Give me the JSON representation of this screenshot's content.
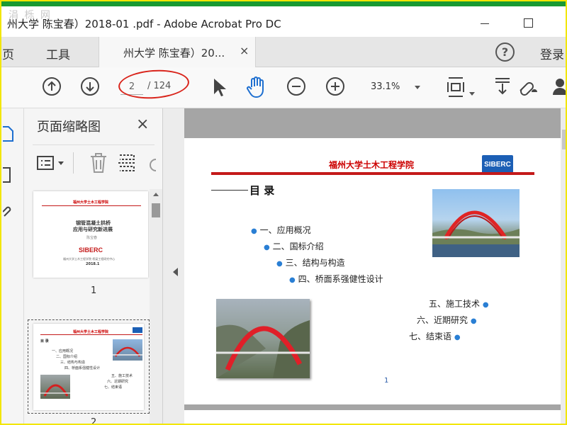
{
  "watermark": "涓 栎 网",
  "window": {
    "title": "州大学 陈宝春）2018-01 .pdf - Adobe Acrobat Pro DC"
  },
  "tabs": {
    "home": "主页",
    "tools": "工具",
    "document": "州大学 陈宝春）20...",
    "close": "×",
    "help": "?",
    "login": "登录"
  },
  "toolbar": {
    "page_current": "2",
    "page_total": "/ 124",
    "zoom": "33.1%"
  },
  "thumbnails": {
    "title": "页面缩略图",
    "close": "×",
    "page1_number": "1",
    "page2_number": "2",
    "page1": {
      "header": "福州大学土木工程学院",
      "title_line1": "钢管混凝土拱桥",
      "title_line2": "应用与研究新进展",
      "author": "陈宝春",
      "logo": "SIBERC",
      "org": "福州大学土木工程学院 桥梁工程研究中心",
      "date": "2018.1"
    }
  },
  "document": {
    "header": "福州大学土木工程学院",
    "logo": "SIBERC",
    "heading": "目 录",
    "items_left": [
      "一、应用概况",
      "二、国标介绍",
      "三、结构与构造",
      "四、桥面系强健性设计"
    ],
    "items_right": [
      "五、施工技术",
      "六、近期研究",
      "七、结束语"
    ],
    "page_number": "1"
  },
  "colors": {
    "title_green": "#1a9a32",
    "frame_yellow": "#f2e600",
    "annotation_red": "#d9241b",
    "doc_red": "#c41a1a",
    "bullet_blue": "#2a7fd4"
  }
}
